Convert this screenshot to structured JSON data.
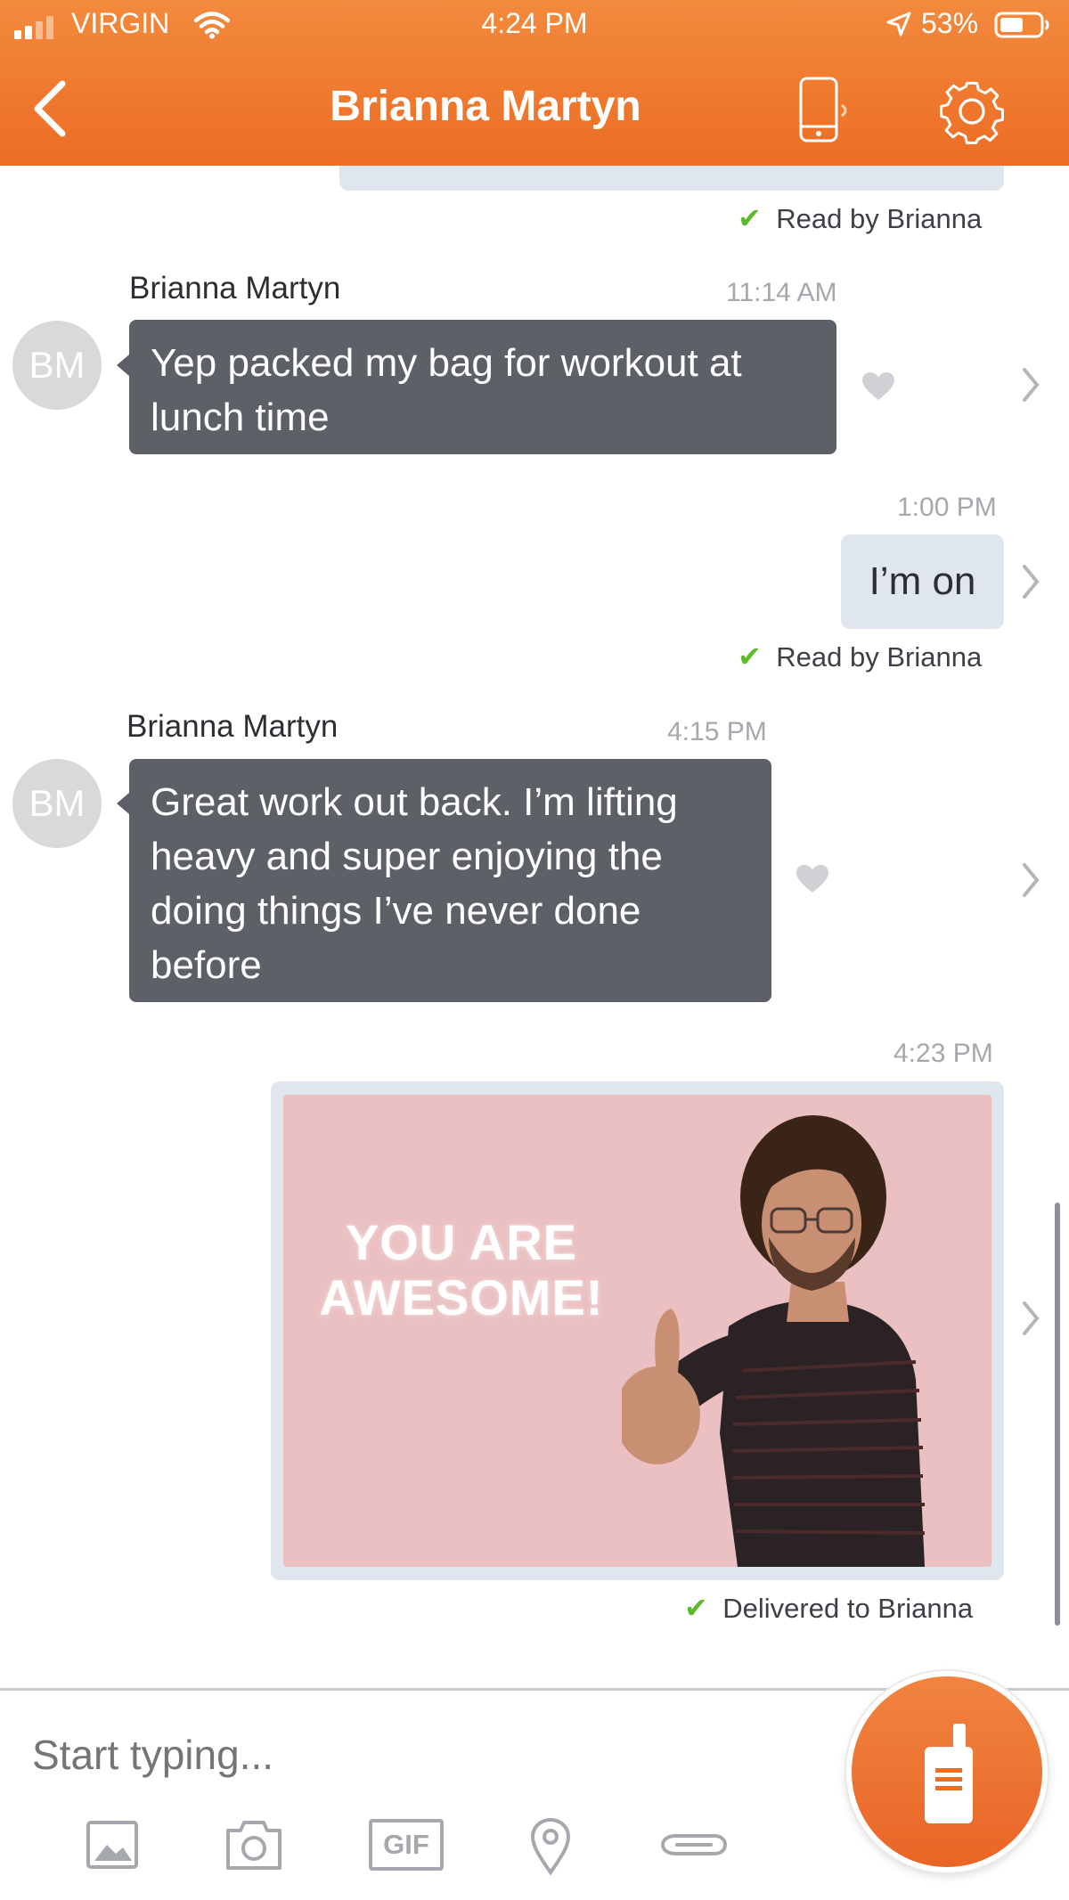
{
  "status_bar": {
    "carrier": "VIRGIN",
    "time": "4:24 PM",
    "battery": "53%"
  },
  "header": {
    "title": "Brianna Martyn"
  },
  "colors": {
    "accent": "#ec6d24",
    "incoming_bubble": "#5d6167",
    "outgoing_bubble": "#dfe6ed",
    "read_check": "#5dbb2a"
  },
  "messages": [
    {
      "status": "Read by Brianna"
    },
    {
      "sender": "Brianna Martyn",
      "time": "11:14 AM",
      "avatar": "BM",
      "text_lines": [
        "Yep packed my bag for workout at",
        "lunch time"
      ]
    },
    {
      "time": "1:00 PM",
      "text": "I’m on",
      "status": "Read by Brianna"
    },
    {
      "sender": "Brianna Martyn",
      "time": "4:15 PM",
      "avatar": "BM",
      "text_lines": [
        "Great work out back. I’m lifting",
        "heavy and super enjoying the",
        "doing things I’ve never done",
        "before"
      ]
    },
    {
      "time": "4:23 PM",
      "gif_text_lines": [
        "YOU ARE",
        "AWESOME!"
      ],
      "status": "Delivered to Brianna"
    }
  ],
  "composer": {
    "placeholder": "Start typing...",
    "gif_label": "GIF"
  }
}
